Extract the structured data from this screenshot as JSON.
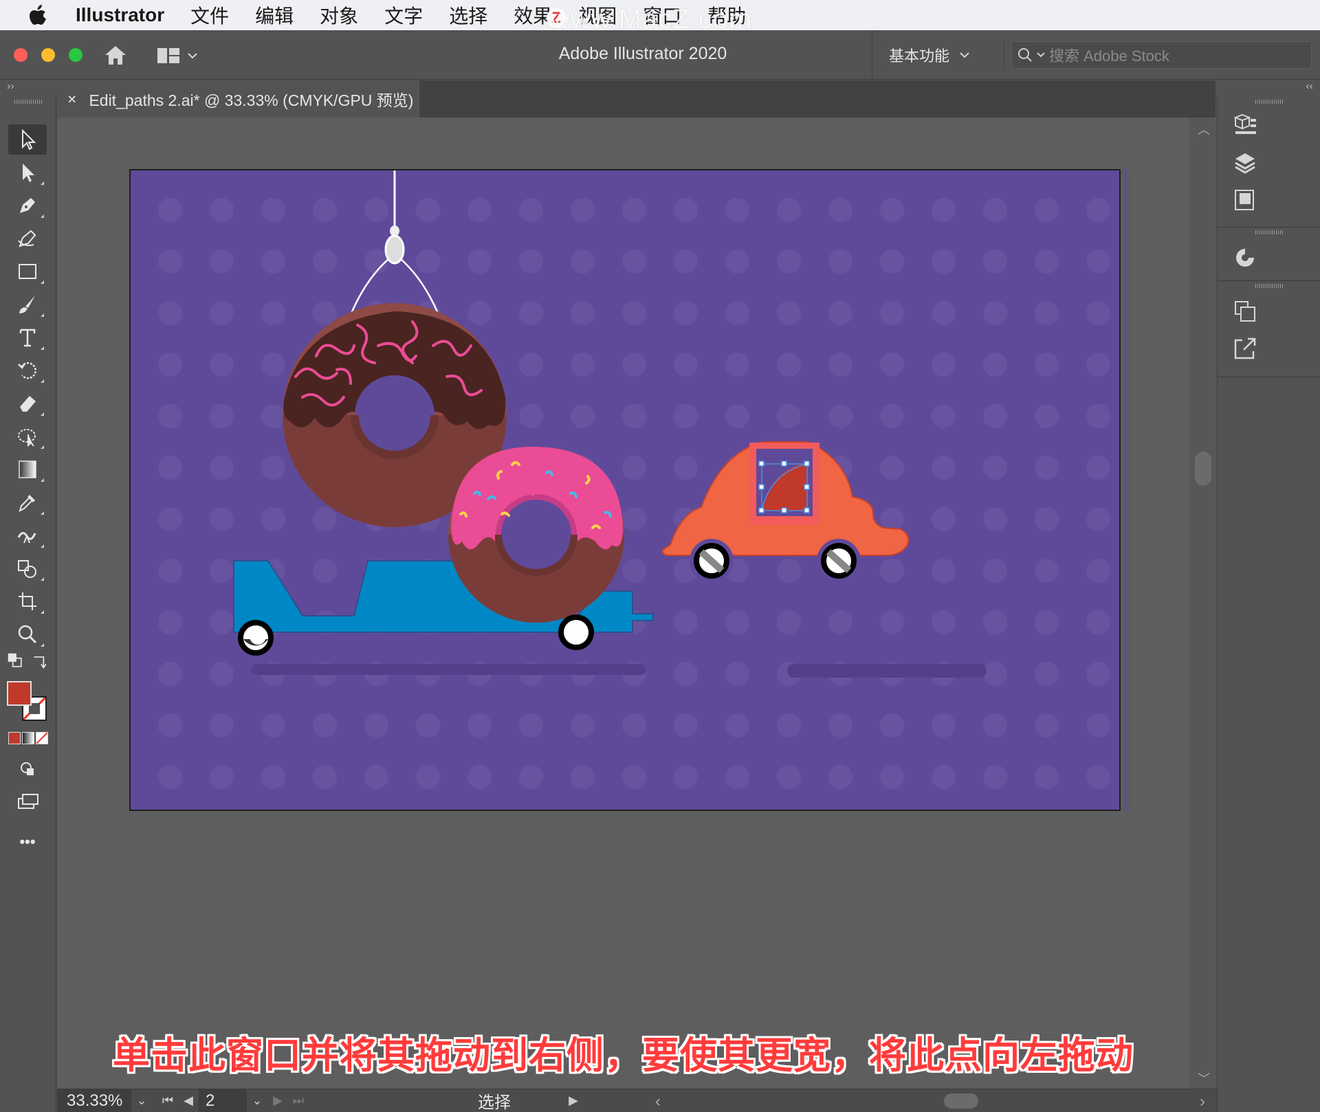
{
  "menubar": {
    "app_name": "Illustrator",
    "items": [
      "文件",
      "编辑",
      "对象",
      "文字",
      "选择",
      "效果",
      "视图",
      "窗口",
      "帮助"
    ],
    "watermark": "www.MacZ.com",
    "watermark_badge": "Z"
  },
  "titlebar": {
    "title": "Adobe Illustrator 2020",
    "workspace": "基本功能",
    "search_placeholder": "搜索 Adobe Stock"
  },
  "document_tab": {
    "label": "Edit_paths 2.ai* @ 33.33% (CMYK/GPU 预览)",
    "close_glyph": "×"
  },
  "toolbar": {
    "tools": [
      "selection-tool",
      "direct-selection-tool",
      "pen-tool",
      "curvature-tool",
      "rectangle-tool",
      "paintbrush-tool",
      "type-tool",
      "rotate-tool",
      "eraser-tool",
      "puppet-warp-tool",
      "gradient-tool",
      "eyedropper-tool",
      "width-tool",
      "shape-builder-tool",
      "artboard-tool",
      "zoom-tool"
    ],
    "fill_color": "#c0392b",
    "more_glyph": "•••"
  },
  "canvas": {
    "subtitle": "单击此窗口并将其拖动到右侧，要使其更宽，将此点向左拖动"
  },
  "statusbar": {
    "zoom": "33.33%",
    "page": "2",
    "status": "选择"
  },
  "colors": {
    "artboard_bg": "#5f4a9a",
    "car": "#f06543",
    "trailer": "#0088c6",
    "pink_frosting": "#ea4c95",
    "chocolate": "#4a2420",
    "donut_dough": "#8e4a46",
    "selection": "#4a90e2"
  }
}
